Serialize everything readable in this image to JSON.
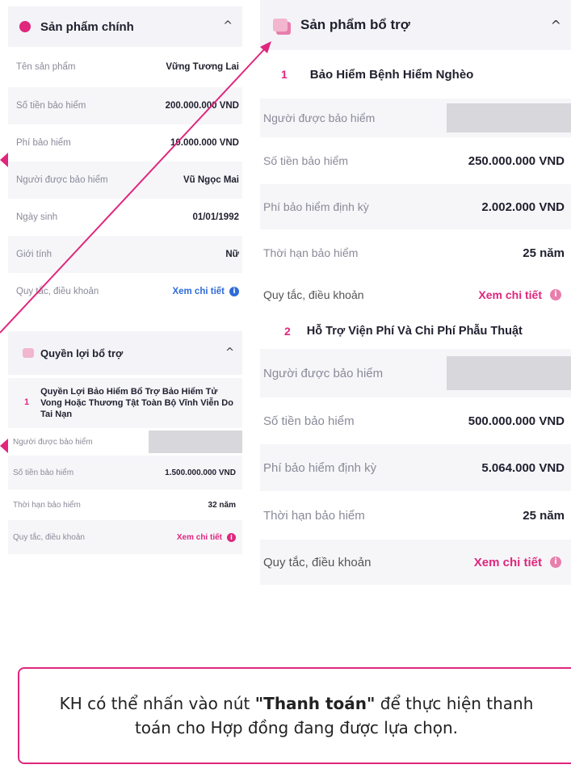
{
  "left": {
    "main_section": {
      "title": "Sản phẩm chính",
      "rows": [
        {
          "label": "Tên sản phẩm",
          "value": "Vững Tương Lai"
        },
        {
          "label": "Số tiền bảo hiểm",
          "value": "200.000.000 VND"
        },
        {
          "label": "Phí bảo hiểm",
          "value": "10.000.000 VND"
        },
        {
          "label": "Người được bảo hiểm",
          "value": "Vũ Ngọc Mai"
        },
        {
          "label": "Ngày sinh",
          "value": "01/01/1992"
        },
        {
          "label": "Giới tính",
          "value": "Nữ"
        },
        {
          "label": "Quy tắc, điều khoản",
          "value": "Xem chi tiết"
        }
      ]
    },
    "rider_section": {
      "title": "Quyền lợi bổ trợ",
      "item_number": "1",
      "item_title": "Quyền Lợi Bảo Hiểm Bổ Trợ Bảo Hiểm Tử Vong Hoặc Thương Tật Toàn Bộ Vĩnh Viễn Do Tai Nạn",
      "rows": [
        {
          "label": "Người được bảo hiểm",
          "value": ""
        },
        {
          "label": "Số tiền bảo hiểm",
          "value": "1.500.000.000 VND"
        },
        {
          "label": "Thời hạn bảo hiểm",
          "value": "32 năm"
        },
        {
          "label": "Quy tắc, điều khoản",
          "value": "Xem chi tiết"
        }
      ]
    }
  },
  "right": {
    "title": "Sản phẩm bổ trợ",
    "products": [
      {
        "number": "1",
        "name": "Bảo Hiểm Bệnh Hiểm Nghèo",
        "rows": [
          {
            "label": "Người được bảo hiểm",
            "value": ""
          },
          {
            "label": "Số tiền bảo hiểm",
            "value": "250.000.000 VND"
          },
          {
            "label": "Phí bảo hiểm định kỳ",
            "value": "2.002.000 VND"
          },
          {
            "label": "Thời hạn bảo hiểm",
            "value": "25 năm"
          },
          {
            "label": "Quy tắc, điều khoản",
            "value": "Xem chi tiết"
          }
        ]
      },
      {
        "number": "2",
        "name": "Hỗ Trợ Viện Phí Và Chi Phí Phẫu Thuật",
        "rows": [
          {
            "label": "Người được bảo hiểm",
            "value": ""
          },
          {
            "label": "Số tiền bảo hiểm",
            "value": "500.000.000 VND"
          },
          {
            "label": "Phí bảo hiểm định kỳ",
            "value": "5.064.000 VND"
          },
          {
            "label": "Thời hạn bảo hiểm",
            "value": "25 năm"
          },
          {
            "label": "Quy tắc, điều khoản",
            "value": "Xem chi tiết"
          }
        ]
      }
    ]
  },
  "note": {
    "prefix": "KH có thể nhấn vào nút ",
    "emphasis": "\"Thanh toán\"",
    "suffix": " để thực hiện thanh toán cho Hợp đồng đang được lựa chọn."
  },
  "colors": {
    "accent": "#e0267d",
    "link_blue": "#2f6bd8",
    "header_bg": "#f4f4f8",
    "placeholder": "#d7d7dc"
  },
  "icons": {
    "info": "i",
    "chevron": "^"
  }
}
